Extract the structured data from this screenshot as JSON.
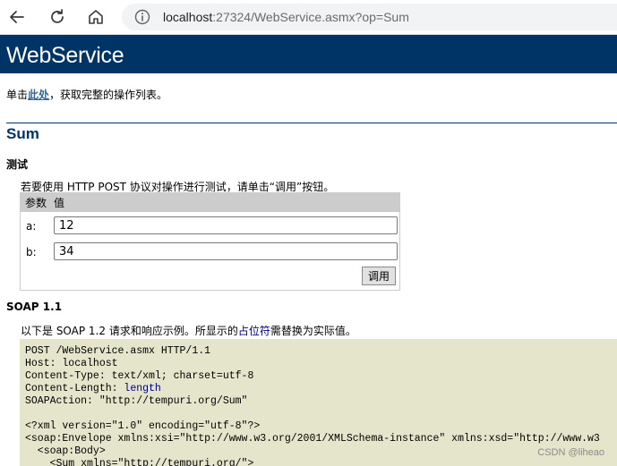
{
  "browser": {
    "url_host": "localhost",
    "url_rest": ":27324/WebService.asmx?op=Sum"
  },
  "page": {
    "title": "WebService",
    "intro_prefix": "单击",
    "intro_link": "此处",
    "intro_suffix": "，获取完整的操作列表。",
    "operation": "Sum"
  },
  "test": {
    "heading": "测试",
    "description": "若要使用 HTTP POST 协议对操作进行测试，请单击“调用”按钮。",
    "col_param": "参数",
    "col_value": "值",
    "params": [
      {
        "label": "a:",
        "value": "12"
      },
      {
        "label": "b:",
        "value": "34"
      }
    ],
    "invoke_label": "调用"
  },
  "soap": {
    "heading": "SOAP 1.1",
    "desc_prefix": "以下是 SOAP 1.2 请求和响应示例。所显示的",
    "desc_placeholder": "占位符",
    "desc_suffix": "需替换为实际值。",
    "code": [
      [
        "POST /WebService.asmx HTTP/1.1"
      ],
      [
        "Host: localhost"
      ],
      [
        "Content-Type: text/xml; charset=utf-8"
      ],
      [
        "Content-Length: ",
        "length"
      ],
      [
        "SOAPAction: \"http://tempuri.org/Sum\""
      ],
      [
        ""
      ],
      [
        "<?xml version=\"1.0\" encoding=\"utf-8\"?>"
      ],
      [
        "<soap:Envelope xmlns:xsi=\"http://www.w3.org/2001/XMLSchema-instance\" xmlns:xsd=\"http://www.w3"
      ],
      [
        "  <soap:Body>"
      ],
      [
        "    <Sum xmlns=\"http://tempuri.org/\">"
      ]
    ]
  },
  "watermark": "CSDN @liheao"
}
